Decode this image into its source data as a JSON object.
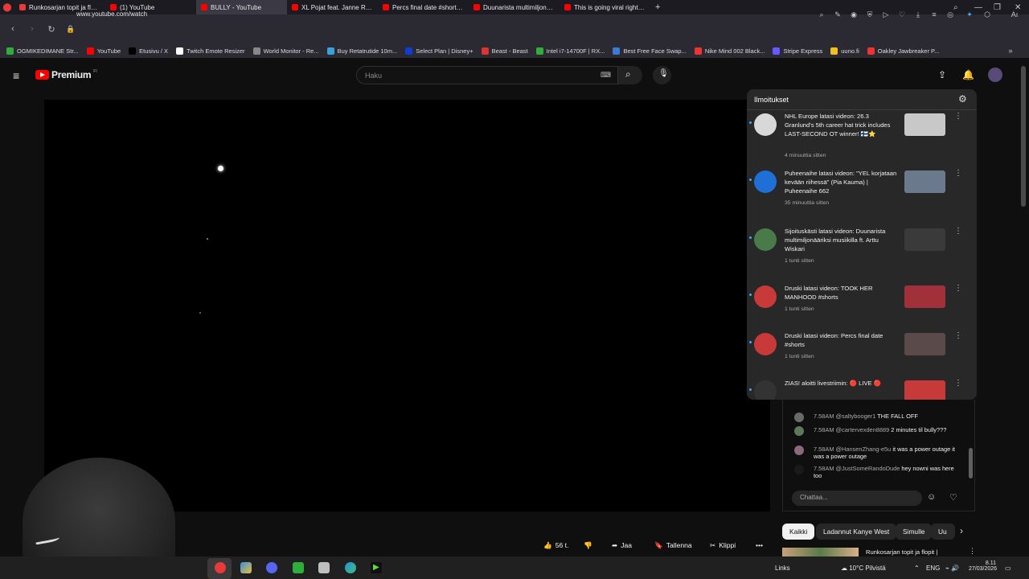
{
  "browser": {
    "tabs": [
      {
        "label": "Runkosarjan topit ja flopit",
        "color": "#e83a3a",
        "active": false
      },
      {
        "label": "(1) YouTube",
        "color": "#ff0000",
        "active": false
      },
      {
        "label": "BULLY - YouTube",
        "color": "#ff0000",
        "active": true
      },
      {
        "label": "XL Pojat feat. Janne Ranta",
        "color": "#ff0000",
        "active": false
      },
      {
        "label": "Percs final date #shorts - Y",
        "color": "#ff0000",
        "active": false
      },
      {
        "label": "Duunarista multimiljonääri",
        "color": "#ff0000",
        "active": false
      },
      {
        "label": "This is going viral right no",
        "color": "#ff0000",
        "active": false
      }
    ],
    "new_tab": "+",
    "url": "www.youtube.com/watch",
    "bookmarks": [
      {
        "label": "OGMIKEDIMANE Str...",
        "color": "#2fae3b"
      },
      {
        "label": "YouTube",
        "color": "#ff0000"
      },
      {
        "label": "Etusivu / X",
        "color": "#000000"
      },
      {
        "label": "Twitch Emote Resizer",
        "color": "#ffffff"
      },
      {
        "label": "World Monitor - Re...",
        "color": "#888888"
      },
      {
        "label": "Buy Retatrutide 10m...",
        "color": "#3aa0d8"
      },
      {
        "label": "Select Plan | Disney+",
        "color": "#113ccf"
      },
      {
        "label": "Beast - Beast",
        "color": "#d33"
      },
      {
        "label": "Intel i7-14700F | RX...",
        "color": "#2fae3b"
      },
      {
        "label": "Best Free Face Swap...",
        "color": "#3a7bd5"
      },
      {
        "label": "Nike Mind 002 Black...",
        "color": "#e33"
      },
      {
        "label": "Stripe Express",
        "color": "#635bff"
      },
      {
        "label": "uuno.fi",
        "color": "#f0c020"
      },
      {
        "label": "Oakley Jawbreaker P...",
        "color": "#e33"
      }
    ]
  },
  "youtube": {
    "logo_text": "Premium",
    "logo_sup": "FI",
    "search_placeholder": "Haku",
    "notifications": {
      "title": "Ilmoitukset",
      "items": [
        {
          "text": "NHL Europe latasi videon: 26.3 Granlund's 5th career hat trick includes LAST-SECOND OT winner! 🇫🇮⭐",
          "time": "4 minuuttia sitten",
          "avatar_color": "#d8d8d8",
          "thumb_color": "#c8c8c8"
        },
        {
          "text": "Puheenaihe latasi videon: \"YEL korjataan kevään riihessä\" (Pia Kauma) | Puheenaihe 662",
          "time": "35 minuuttia sitten",
          "avatar_color": "#1f6fd6",
          "thumb_color": "#6a7a8c"
        },
        {
          "text": "Sijoituskästi latasi videon: Duunarista multimiljonääriksi musiikilla ft. Arttu Wiskari",
          "time": "1 tunti sitten",
          "avatar_color": "#4a7a4a",
          "thumb_color": "#3a3a3a"
        },
        {
          "text": "Druski latasi videon: TOOK HER MANHOOD #shorts",
          "time": "1 tunti sitten",
          "avatar_color": "#c83a3a",
          "thumb_color": "#a0303a"
        },
        {
          "text": "Druski latasi videon: Percs final date #shorts",
          "time": "1 tunti sitten",
          "avatar_color": "#c83a3a",
          "thumb_color": "#5a4a4a"
        },
        {
          "text": "ZIAS! aloitti livestriimin: 🔴 LIVE 🔴",
          "time": "",
          "avatar_color": "#333333",
          "thumb_color": "#c83a3a"
        }
      ]
    },
    "chat": {
      "messages": [
        {
          "time": "7.58AM",
          "name": "@saltybooger1",
          "text": "THE FALL OFF",
          "avatar_color": "#6a6a6a"
        },
        {
          "time": "7.58AM",
          "name": "@cartervexden8889",
          "text": "2 minutes til bully???",
          "avatar_color": "#5a7a5a"
        },
        {
          "time": "7.58AM",
          "name": "@HansenZhang-e5u",
          "text": "it was a power outage it was a power outage",
          "avatar_color": "#8a6a7a"
        },
        {
          "time": "7.58AM",
          "name": "@JustSomeRandoDude",
          "text": "hey nowni was here too",
          "avatar_color": "#1a1a1a"
        }
      ],
      "input_placeholder": "Chattaa..."
    },
    "actions": {
      "like_count": "56 t.",
      "share": "Jaa",
      "save": "Tallenna",
      "clip": "Klippi",
      "more": "•••"
    },
    "chips": [
      "Kaikki",
      "Ladannut Kanye West",
      "Simulle",
      "Uu"
    ],
    "related_title": "Runkosarjan topit ja flopit |"
  },
  "taskbar": {
    "links": "Links",
    "weather": "10°C Pilvistä",
    "lang": "ENG",
    "time": "8.11",
    "date": "27/03/2026"
  }
}
